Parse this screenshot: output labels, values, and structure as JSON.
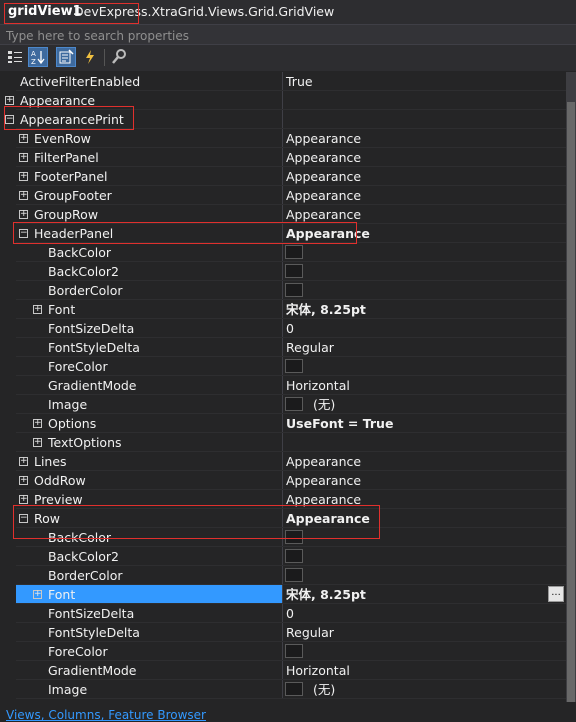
{
  "header": {
    "component": "gridView1",
    "type": "DevExpress.XtraGrid.Views.Grid.GridView"
  },
  "search": {
    "placeholder": "Type here to search properties"
  },
  "toolbar": {
    "buttons": [
      {
        "name": "categorized-view-icon"
      },
      {
        "name": "alphabetical-sort-icon"
      },
      {
        "name": "properties-icon"
      },
      {
        "name": "events-icon"
      },
      {
        "name": "property-pages-icon"
      }
    ]
  },
  "rows": [
    {
      "name": "ActiveFilterEnabled",
      "value": "True"
    },
    {
      "name": "Appearance",
      "value": ""
    },
    {
      "name": "AppearancePrint",
      "value": ""
    },
    {
      "name": "EvenRow",
      "value": "Appearance"
    },
    {
      "name": "FilterPanel",
      "value": "Appearance"
    },
    {
      "name": "FooterPanel",
      "value": "Appearance"
    },
    {
      "name": "GroupFooter",
      "value": "Appearance"
    },
    {
      "name": "GroupRow",
      "value": "Appearance"
    },
    {
      "name": "HeaderPanel",
      "value": "Appearance"
    },
    {
      "name": "BackColor",
      "value": ""
    },
    {
      "name": "BackColor2",
      "value": ""
    },
    {
      "name": "BorderColor",
      "value": ""
    },
    {
      "name": "Font",
      "value": "宋体, 8.25pt"
    },
    {
      "name": "FontSizeDelta",
      "value": "0"
    },
    {
      "name": "FontStyleDelta",
      "value": "Regular"
    },
    {
      "name": "ForeColor",
      "value": ""
    },
    {
      "name": "GradientMode",
      "value": "Horizontal"
    },
    {
      "name": "Image",
      "value": "(无)"
    },
    {
      "name": "Options",
      "value": "UseFont = True"
    },
    {
      "name": "TextOptions",
      "value": ""
    },
    {
      "name": "Lines",
      "value": "Appearance"
    },
    {
      "name": "OddRow",
      "value": "Appearance"
    },
    {
      "name": "Preview",
      "value": "Appearance"
    },
    {
      "name": "Row",
      "value": "Appearance"
    },
    {
      "name": "BackColor",
      "value": ""
    },
    {
      "name": "BackColor2",
      "value": ""
    },
    {
      "name": "BorderColor",
      "value": ""
    },
    {
      "name": "Font",
      "value": "宋体, 8.25pt"
    },
    {
      "name": "FontSizeDelta",
      "value": "0"
    },
    {
      "name": "FontStyleDelta",
      "value": "Regular"
    },
    {
      "name": "ForeColor",
      "value": ""
    },
    {
      "name": "GradientMode",
      "value": "Horizontal"
    },
    {
      "name": "Image",
      "value": "(无)"
    }
  ],
  "ellipsis_label": "...",
  "footer": {
    "link": "Views, Columns, Feature Browser"
  },
  "colors": {
    "highlight": "#e0302d",
    "selection": "#3399ff",
    "background": "#252526"
  }
}
